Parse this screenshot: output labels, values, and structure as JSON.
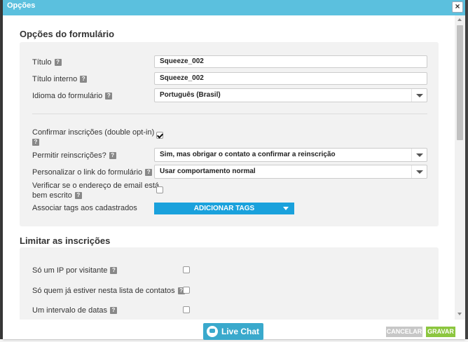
{
  "dialog": {
    "title": "Opções",
    "close_label": "×"
  },
  "form_options": {
    "section_title": "Opções do formulário",
    "title_label": "Título",
    "title_value": "Squeeze_002",
    "internal_title_label": "Título interno",
    "internal_title_value": "Squeeze_002",
    "language_label": "Idioma do formulário",
    "language_value": "Português (Brasil)",
    "confirm_label_line1": "Confirmar inscrições (double opt-in)",
    "confirm_checked": true,
    "allow_resub_label": "Permitir reinscrições?",
    "allow_resub_value": "Sim, mas obrigar o contato a confirmar a reinscrição",
    "custom_link_label": "Personalizar o link do formulário",
    "custom_link_value": "Usar comportamento normal",
    "verify_email_line1": "Verificar se o endereço de email está",
    "verify_email_line2": "bem escrito",
    "verify_email_checked": false,
    "tags_label": "Associar tags aos cadastrados",
    "tags_button": "ADICIONAR TAGS"
  },
  "limits": {
    "section_title": "Limitar as inscrições",
    "one_ip_label": "Só um IP por visitante",
    "in_list_label": "Só quem já estiver nesta lista de contatos",
    "date_range_label": "Um intervalo de datas"
  },
  "help_glyph": "?",
  "footer": {
    "live_chat": "Live Chat",
    "cancel": "CANCELAR",
    "save": "GRAVAR"
  },
  "colors": {
    "titlebar": "#5bc0de",
    "tags_button": "#1aa1dc",
    "save": "#8cc63f",
    "cancel": "#c7c7c7",
    "live_chat": "#3aa9cc"
  }
}
